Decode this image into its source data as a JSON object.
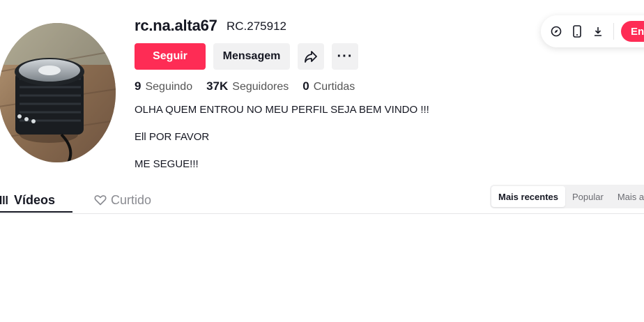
{
  "profile": {
    "username": "rc.na.alta67",
    "nickname": "RC.275912",
    "follow_label": "Seguir",
    "message_label": "Mensagem",
    "more_label": "···",
    "stats": [
      {
        "value": "9",
        "label": "Seguindo"
      },
      {
        "value": "37K",
        "label": "Seguidores"
      },
      {
        "value": "0",
        "label": "Curtidas"
      }
    ],
    "bio": [
      "OLHA QUEM ENTROU NO MEU PERFIL SEJA BEM VINDO !!!",
      "Ell POR FAVOR",
      "ME SEGUE!!!"
    ]
  },
  "toolbar": {
    "icons": [
      "compass-icon",
      "mobile-icon",
      "download-icon"
    ],
    "enter_label": "Ent"
  },
  "tabs": [
    {
      "label": "Vídeos",
      "icon": "grid-icon",
      "active": true
    },
    {
      "label": "Curtido",
      "icon": "heart-outline-icon",
      "active": false
    }
  ],
  "sort": {
    "options": [
      "Mais recentes",
      "Popular",
      "Mais ant"
    ],
    "selected": "Mais recentes"
  },
  "colors": {
    "accent": "#fe2c55",
    "button_gray": "#f1f1f2",
    "text": "#161823"
  }
}
